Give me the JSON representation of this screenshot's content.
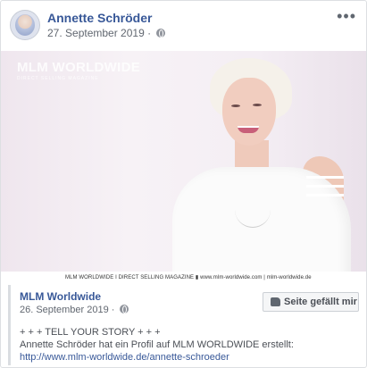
{
  "post": {
    "author": "Annette Schröder",
    "date": "27. September 2019 ·",
    "privacy_icon": "globe-icon",
    "more_icon": "ellipsis-icon",
    "more_glyph": "•••"
  },
  "image": {
    "watermark_title": "MLM WORLDWIDE",
    "watermark_subtitle": "DIRECT SELLING MAGAZINE",
    "caption": "MLM WORLDWIDE I DIRECT SELLING MAGAZINE  ▮  www.mlm-worldwide.com | mlm-worldwide.de"
  },
  "shared": {
    "author": "MLM Worldwide",
    "date": "26. September 2019 ·",
    "like_button": "Seite gefällt mir",
    "line1": "+ + + TELL YOUR STORY + + +",
    "line2_prefix": "Annette Schröder hat ein Profil auf MLM WORLDWIDE erstellt: ",
    "link": "http://www.mlm-worldwide.de/annette-schroeder"
  },
  "colors": {
    "link_blue": "#385898",
    "meta_gray": "#616770",
    "border": "#dddfe2"
  }
}
